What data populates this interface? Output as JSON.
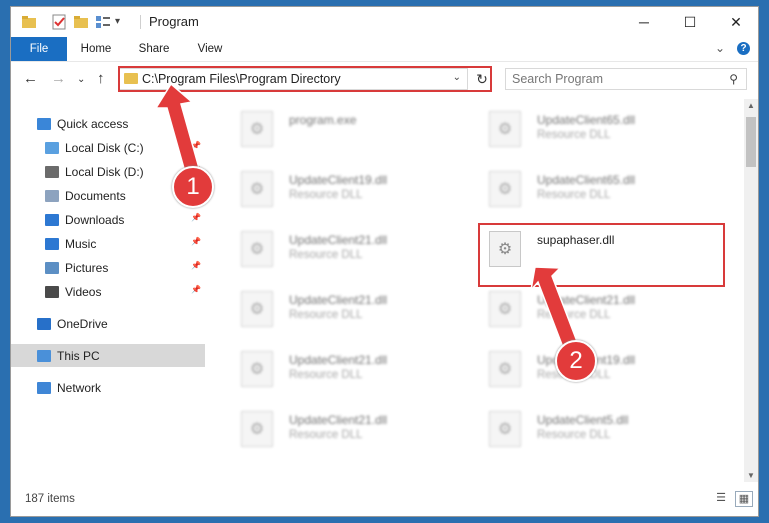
{
  "window": {
    "title": "Program",
    "minimize_glyph": "─",
    "maximize_glyph": "☐",
    "close_glyph": "✕"
  },
  "ribbon": {
    "tabs": [
      "File",
      "Home",
      "Share",
      "View"
    ],
    "expand_glyph": "⌄",
    "help_glyph": "?"
  },
  "nav": {
    "back_glyph": "←",
    "forward_glyph": "→",
    "recent_glyph": "⌄",
    "up_glyph": "↑",
    "address": "C:\\Program Files\\Program Directory",
    "refresh_glyph": "↻",
    "search_placeholder": "Search Program"
  },
  "sidebar": {
    "items": [
      {
        "label": "Quick access",
        "icon": "star-icon",
        "color": "#3a86d8"
      },
      {
        "label": "Local Disk (C:)",
        "icon": "drive-icon",
        "color": "#5aa0e0",
        "pinned": true
      },
      {
        "label": "Local Disk (D:)",
        "icon": "drive-icon",
        "color": "#6b6b6b",
        "pinned": true
      },
      {
        "label": "Documents",
        "icon": "documents-icon",
        "color": "#8da3bf",
        "pinned": true
      },
      {
        "label": "Downloads",
        "icon": "download-icon",
        "color": "#2d78d2",
        "pinned": true
      },
      {
        "label": "Music",
        "icon": "music-icon",
        "color": "#2d78d2",
        "pinned": true
      },
      {
        "label": "Pictures",
        "icon": "pictures-icon",
        "color": "#5c8fc4",
        "pinned": true
      },
      {
        "label": "Videos",
        "icon": "videos-icon",
        "color": "#4a4a4a",
        "pinned": true
      },
      {
        "label": "OneDrive",
        "icon": "cloud-icon",
        "color": "#2770c9"
      },
      {
        "label": "This PC",
        "icon": "pc-icon",
        "color": "#4a90d9",
        "selected": true
      },
      {
        "label": "Network",
        "icon": "network-icon",
        "color": "#3f86d6"
      }
    ]
  },
  "files": {
    "left": [
      {
        "name": "program.exe",
        "type": ""
      },
      {
        "name": "UpdateClient19.dll",
        "type": "Resource DLL"
      },
      {
        "name": "UpdateClient21.dll",
        "type": "Resource DLL"
      },
      {
        "name": "UpdateClient21.dll",
        "type": "Resource DLL"
      },
      {
        "name": "UpdateClient21.dll",
        "type": "Resource DLL"
      },
      {
        "name": "UpdateClient21.dll",
        "type": "Resource DLL"
      }
    ],
    "right": [
      {
        "name": "UpdateClient65.dll",
        "type": "Resource DLL"
      },
      {
        "name": "UpdateClient65.dll",
        "type": "Resource DLL"
      },
      {
        "name": "supaphaser.dll",
        "type": ""
      },
      {
        "name": "UpdateClient21.dll",
        "type": "Resource DLL"
      },
      {
        "name": "UpdateClient19.dll",
        "type": "Resource DLL"
      },
      {
        "name": "UpdateClient5.dll",
        "type": "Resource DLL"
      }
    ]
  },
  "status": {
    "count": "187 items"
  },
  "annotations": {
    "step1": "1",
    "step2": "2",
    "color": "#e23b3b"
  },
  "colors": {
    "accent": "#1a6ec2",
    "highlight": "#d83a3a",
    "selected_bg": "#d8d8d8"
  }
}
